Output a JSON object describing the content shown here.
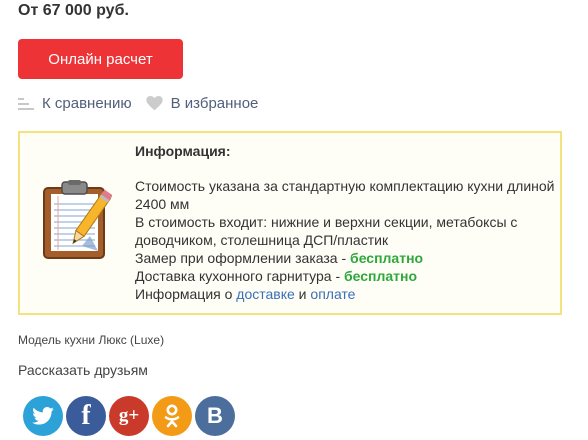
{
  "product": {
    "price_text": "От 67 000 руб.",
    "calc_button_label": "Онлайн расчет"
  },
  "actions": {
    "compare_label": "К сравнению",
    "favorite_label": "В избранное"
  },
  "info": {
    "title": "Информация:",
    "line_cost": "Стоимость указана за стандартную комплектацию кухни длиной 2400 мм",
    "line_includes": "В стоимость входит: нижние и верхни секции, метабоксы с доводчиком, столешница ДСП/пластик",
    "measure_prefix": "Замер при оформлении заказа - ",
    "measure_value": "бесплатно",
    "delivery_prefix": "Доставка кухонного гарнитура - ",
    "delivery_value": "бесплатно",
    "info_prefix": "Информация о ",
    "info_link_delivery": "доставке",
    "info_and": " и ",
    "info_link_payment": "оплате",
    "icon": "clipboard-pencil-icon"
  },
  "model_text": "Модель кухни Люкс (Luxe)",
  "share": {
    "label": "Рассказать друзьям",
    "networks": [
      {
        "name": "twitter",
        "icon": "twitter-icon",
        "glyph": "",
        "color": "#2da2d8"
      },
      {
        "name": "facebook",
        "icon": "facebook-icon",
        "glyph": "f",
        "color": "#3b5c9a"
      },
      {
        "name": "google-plus",
        "icon": "google-plus-icon",
        "glyph": "g+",
        "color": "#c93a2b"
      },
      {
        "name": "odnoklassniki",
        "icon": "odnoklassniki-icon",
        "glyph": "",
        "color": "#f39a17"
      },
      {
        "name": "vkontakte",
        "icon": "vkontakte-icon",
        "glyph": "B",
        "color": "#4b6e9c"
      }
    ]
  },
  "colors": {
    "accent_button": "#ee3337",
    "free_text": "#2fa83b",
    "link": "#3a6fb4",
    "info_border": "#f4e27f"
  }
}
